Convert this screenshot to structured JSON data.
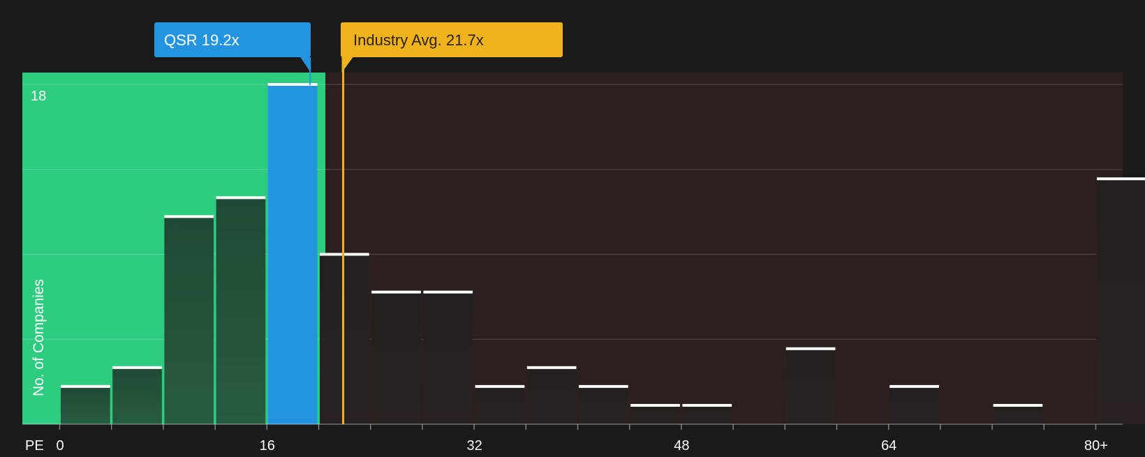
{
  "chart_data": {
    "type": "bar",
    "xlabel": "PE",
    "ylabel": "No. of Companies",
    "x_ticks": [
      "0",
      "16",
      "32",
      "48",
      "64",
      "80+"
    ],
    "y_ticks": [
      "18"
    ],
    "ylim": [
      0,
      18
    ],
    "bin_width": 4,
    "bins": [
      {
        "start": 0,
        "value": 2
      },
      {
        "start": 4,
        "value": 3
      },
      {
        "start": 8,
        "value": 11
      },
      {
        "start": 12,
        "value": 12
      },
      {
        "start": 16,
        "value": 18
      },
      {
        "start": 20,
        "value": 9
      },
      {
        "start": 24,
        "value": 7
      },
      {
        "start": 28,
        "value": 7
      },
      {
        "start": 32,
        "value": 2
      },
      {
        "start": 36,
        "value": 3
      },
      {
        "start": 40,
        "value": 2
      },
      {
        "start": 44,
        "value": 1
      },
      {
        "start": 48,
        "value": 1
      },
      {
        "start": 52,
        "value": 0
      },
      {
        "start": 56,
        "value": 4
      },
      {
        "start": 60,
        "value": 0
      },
      {
        "start": 64,
        "value": 2
      },
      {
        "start": 68,
        "value": 0
      },
      {
        "start": 72,
        "value": 1
      },
      {
        "start": 76,
        "value": 0
      },
      {
        "start": 80,
        "value": 13
      }
    ],
    "highlight_bin_start": 16,
    "company": {
      "label": "QSR 19.2x",
      "value": 19.2
    },
    "industry": {
      "label": "Industry Avg. 21.7x",
      "value": 21.7
    },
    "colors": {
      "background": "#1a1a1a",
      "undervalued_zone": "#2ecc7f",
      "overvalued_zone": "#2e1f1f",
      "company": "#2394e0",
      "industry": "#f0b31c",
      "bar_on_green": "#1f4a35",
      "bar_on_dark": "#242020",
      "bar_cap": "#ffffff",
      "text": "#ffffff"
    }
  }
}
